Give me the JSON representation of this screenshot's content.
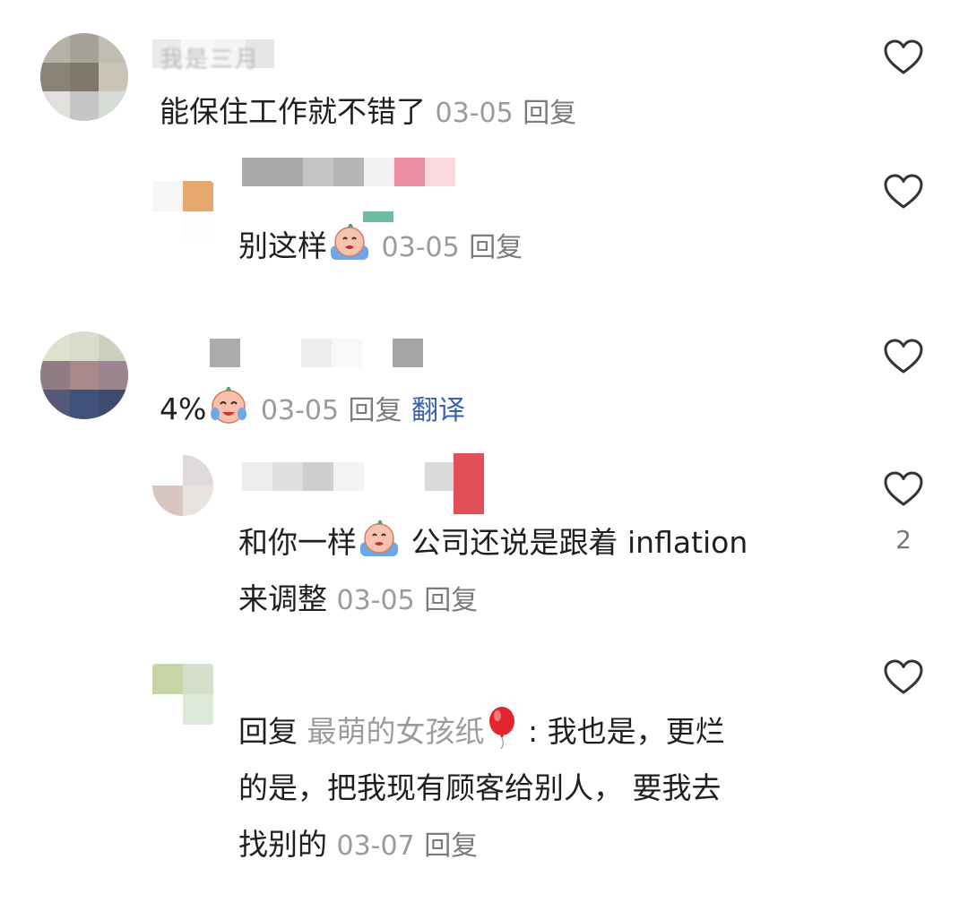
{
  "comments": [
    {
      "username": "我是三月",
      "text": "能保住工作就不错了",
      "date": "03-05",
      "reply_label": "回复",
      "likes": ""
    },
    {
      "username": "",
      "text": "别这样",
      "emoji": "crying-face-emoji",
      "date": "03-05",
      "reply_label": "回复",
      "likes": ""
    },
    {
      "username": "",
      "text": "4%",
      "emoji": "crying-face-emoji",
      "date": "03-05",
      "reply_label": "回复",
      "translate_label": "翻译",
      "likes": ""
    },
    {
      "username": "",
      "text_before": "和你一样",
      "emoji": "crying-face-emoji",
      "text_after_line1": " 公司还说是跟着 inflation",
      "text_line2": "来调整",
      "date": "03-05",
      "reply_label": "回复",
      "likes": "2"
    },
    {
      "username": "",
      "reply_prefix": "回复",
      "reply_to": "最萌的女孩纸",
      "emoji": "balloon-emoji",
      "text_line1": " : 我也是，更烂",
      "text_line2": "的是，把我现有顾客给别人， 要我去",
      "text_line3": "找别的",
      "date": "03-07",
      "reply_label": "回复",
      "likes": ""
    }
  ],
  "colors": {
    "translate": "#3a5dae",
    "meta": "#9b9b9b",
    "heart": "#333333"
  }
}
